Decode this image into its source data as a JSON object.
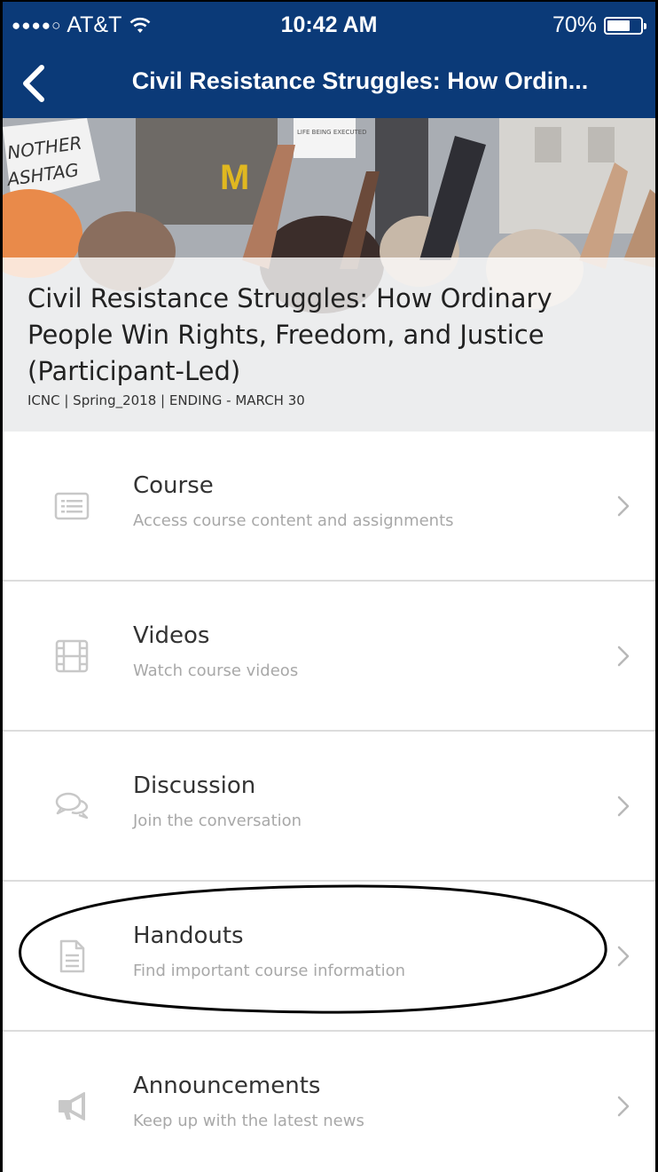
{
  "status_bar": {
    "signal_dots": "●●●●○",
    "carrier": "AT&T",
    "time": "10:42 AM",
    "battery": "70%",
    "battery_level": 0.7
  },
  "nav": {
    "back_icon": "chevron-left-icon",
    "title": "Civil Resistance Struggles: How Ordin..."
  },
  "course": {
    "title": "Civil Resistance Struggles: How Ordinary People Win Rights, Freedom, and Justice (Participant-Led)",
    "meta": "ICNC | Spring_2018 | ENDING - MARCH 30",
    "sign_text_1": "NOTHER",
    "sign_text_2": "ASHTAG",
    "sign_text_3": "LIFE BEING EXECUTED"
  },
  "menu": {
    "items": [
      {
        "label": "Course",
        "subtitle": "Access course content and assignments",
        "icon": "list-icon"
      },
      {
        "label": "Videos",
        "subtitle": "Watch course videos",
        "icon": "film-icon"
      },
      {
        "label": "Discussion",
        "subtitle": "Join the conversation",
        "icon": "chat-bubbles-icon"
      },
      {
        "label": "Handouts",
        "subtitle": "Find important course information",
        "icon": "document-icon"
      },
      {
        "label": "Announcements",
        "subtitle": "Keep up with the latest news",
        "icon": "megaphone-icon"
      }
    ]
  },
  "colors": {
    "nav_background": "#0b3a78",
    "icon_gray": "#c8c8c8",
    "subtitle_gray": "#a8a8a8",
    "divider": "#dcdcdc"
  }
}
